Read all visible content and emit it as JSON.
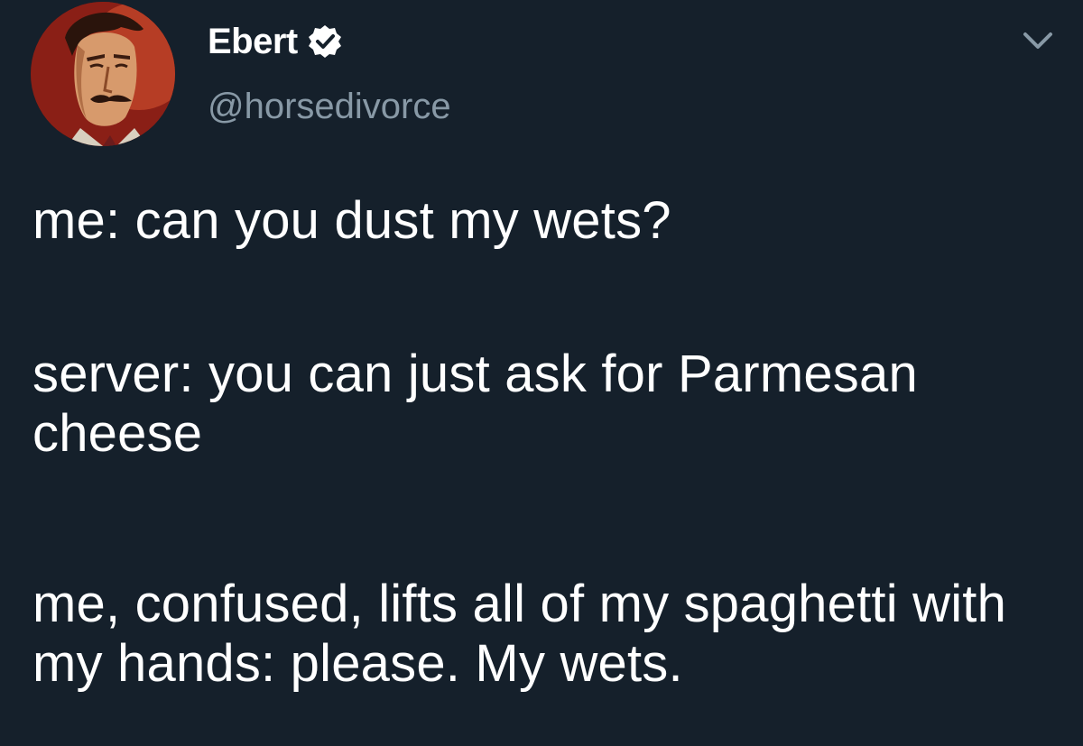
{
  "user": {
    "display_name": "Ebert",
    "handle": "@horsedivorce",
    "verified": true,
    "avatar_icon": "avatar-portrait-icon"
  },
  "menu": {
    "icon": "chevron-down-icon"
  },
  "tweet": {
    "line1": "me: can you dust my wets?",
    "line2": "server: you can just ask for Parmesan cheese",
    "line3": "me, confused, lifts all of my spaghetti with my hands: please. My wets."
  },
  "colors": {
    "background": "#15202b",
    "text": "#ffffff",
    "secondary": "#8899a6",
    "accent": "#1da1f2"
  }
}
